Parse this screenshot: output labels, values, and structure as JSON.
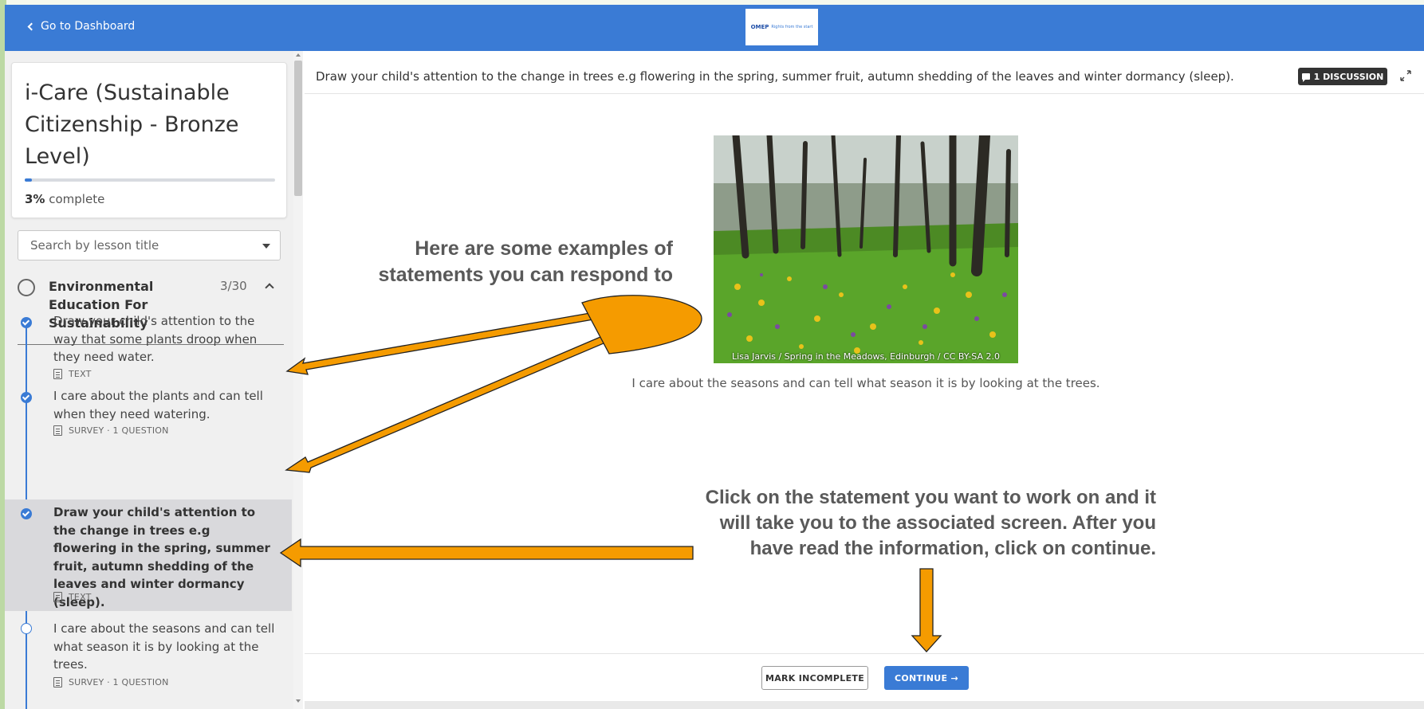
{
  "topbar": {
    "back_label": "Go to Dashboard",
    "logo": {
      "mark": "OMEP",
      "text": "Rights from the start"
    }
  },
  "course": {
    "title": "i-Care (Sustainable Citizenship - Bronze Level)",
    "progress_percent": 3,
    "progress_value": "3%",
    "progress_suffix": " complete"
  },
  "search": {
    "placeholder": "Search by lesson title"
  },
  "section": {
    "title": "Environmental Education For Sustainability",
    "count": "3/30"
  },
  "lessons": [
    {
      "title": "Draw your child's attention to the way that some plants droop when they need water.",
      "meta": "TEXT",
      "completed": true
    },
    {
      "title": "I care about the plants and can tell when they need watering.",
      "meta": "SURVEY · 1 QUESTION",
      "completed": true
    },
    {
      "title": "Draw your child's attention to the change in trees e.g flowering in the spring, summer fruit, autumn shedding of the leaves and winter dormancy (sleep).",
      "meta": "TEXT",
      "completed": true,
      "active": true
    },
    {
      "title": "I care about the seasons and can tell what season it is by looking at the trees.",
      "meta": "SURVEY · 1 QUESTION",
      "completed": false
    }
  ],
  "main": {
    "title": "Draw your child's attention to the change in trees e.g flowering in the spring, summer fruit, autumn shedding of the leaves and winter dormancy (sleep).",
    "discussion_label": "1 DISCUSSION",
    "image_caption": "Lisa Jarvis / Spring in the Meadows, Edinburgh / CC BY-SA 2.0",
    "statement": "I care about the seasons and can tell what season it is by looking at the trees."
  },
  "annotations": {
    "examples_line1": "Here are some examples of",
    "examples_line2": "statements you can respond to",
    "instructions_line1": "Click on the statement you want to work on and it",
    "instructions_line2": "will take you to the associated screen. After you",
    "instructions_line3": "have read the information, click on continue.",
    "arrow_color": "#f59b00"
  },
  "footer": {
    "mark_incomplete": "MARK INCOMPLETE",
    "continue": "CONTINUE →"
  },
  "colors": {
    "brand": "#3a7bd5",
    "sidebar_bg": "#f0f0f0",
    "active_row": "#d9d9dc"
  }
}
